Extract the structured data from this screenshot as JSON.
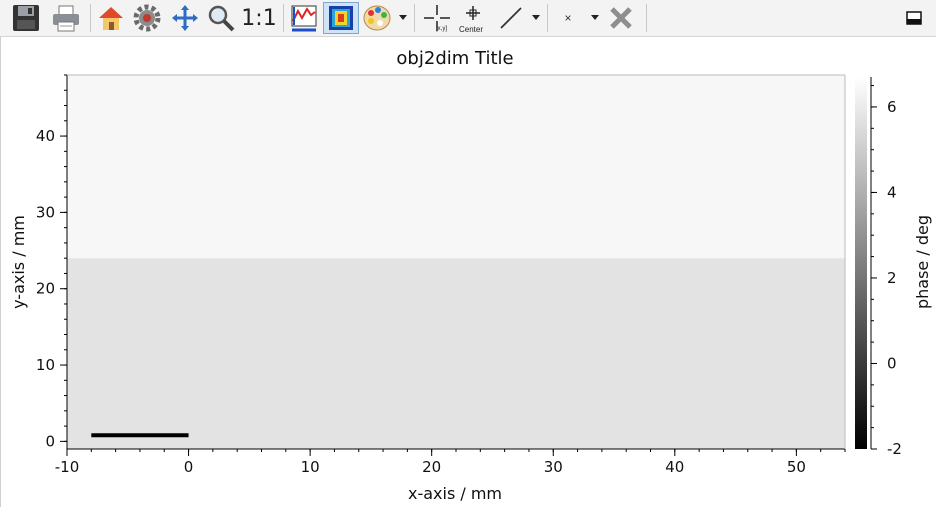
{
  "toolbar": {
    "buttons": [
      {
        "name": "save-icon"
      },
      {
        "name": "print-icon"
      },
      {
        "name": "home-icon"
      },
      {
        "name": "gear-icon"
      },
      {
        "name": "pan-icon"
      },
      {
        "name": "zoom-icon"
      },
      {
        "name": "aspect-ratio-button",
        "label": "1:1"
      },
      {
        "name": "line-profile-icon"
      },
      {
        "name": "colormap-icon"
      },
      {
        "name": "palette-icon"
      },
      {
        "name": "marker-icon",
        "sub_label": "[x,y]"
      },
      {
        "name": "center-marker-icon",
        "label": "Center"
      },
      {
        "name": "line-draw-icon"
      },
      {
        "name": "point-marker-icon",
        "label": "×"
      },
      {
        "name": "delete-icon"
      },
      {
        "name": "window-icon"
      }
    ]
  },
  "plot": {
    "title": "obj2dim Title",
    "colorbar_label": "phase / deg"
  },
  "chart_data": {
    "type": "heatmap",
    "title": "obj2dim Title",
    "xlabel": "x-axis / mm",
    "ylabel": "y-axis / mm",
    "xlim": [
      -10,
      54
    ],
    "ylim": [
      -1,
      48
    ],
    "xticks": [
      -10,
      0,
      10,
      20,
      30,
      40,
      50
    ],
    "yticks": [
      0,
      10,
      20,
      30,
      40
    ],
    "regions": [
      {
        "y_range": [
          -1,
          24
        ],
        "value": 5.4,
        "color": "#e3e3e3"
      },
      {
        "y_range": [
          24,
          48
        ],
        "value": 6.7,
        "color": "#f7f7f7"
      }
    ],
    "scale_bar": {
      "x_start": -8,
      "x_end": 0,
      "y": 0.8
    },
    "colorbar": {
      "label": "phase / deg",
      "range": [
        -2,
        6.7
      ],
      "ticks": [
        -2,
        0,
        2,
        4,
        6
      ]
    },
    "grid": false
  }
}
